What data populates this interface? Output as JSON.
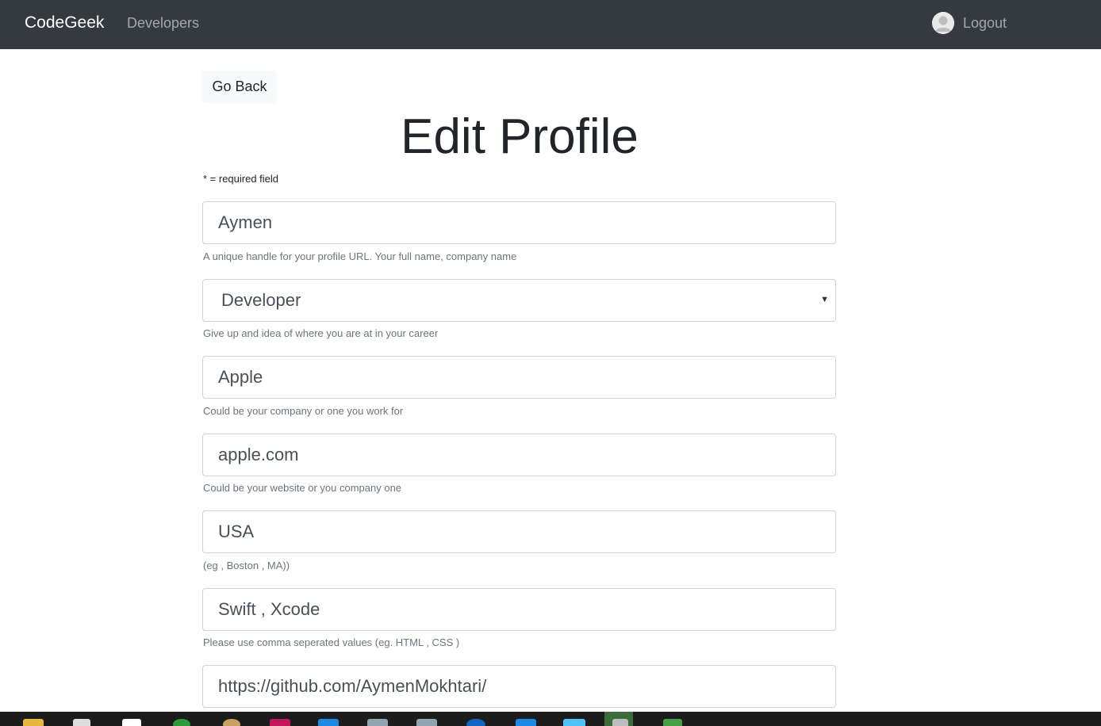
{
  "navbar": {
    "brand": "CodeGeek",
    "developers_link": "Developers",
    "logout_link": "Logout"
  },
  "back_button": "Go Back",
  "page_title": "Edit Profile",
  "required_note": "* = required field",
  "form": {
    "handle": {
      "value": "Aymen",
      "help": "A unique handle for your profile URL. Your full name, company name"
    },
    "status": {
      "value": "Developer",
      "help": "Give up and idea of where you are at in your career"
    },
    "company": {
      "value": "Apple",
      "help": "Could be your company or one you work for"
    },
    "website": {
      "value": "apple.com",
      "help": "Could be your website or you company one"
    },
    "location": {
      "value": "USA",
      "help": "(eg , Boston , MA))"
    },
    "skills": {
      "value": "Swift , Xcode",
      "help": "Please use comma seperated values (eg. HTML , CSS )"
    },
    "github": {
      "value": "https://github.com/AymenMokhtari/"
    }
  },
  "colors": {
    "navbar_bg": "#343a40",
    "help_text": "#6c757d",
    "input_border": "#ced4da"
  },
  "taskbar_icons": [
    "file-explorer-icon",
    "store-icon",
    "app-icon",
    "app-icon",
    "app-icon",
    "app-icon",
    "app-icon",
    "app-icon",
    "app-icon",
    "app-icon",
    "app-icon",
    "app-icon",
    "app-icon",
    "app-icon"
  ]
}
